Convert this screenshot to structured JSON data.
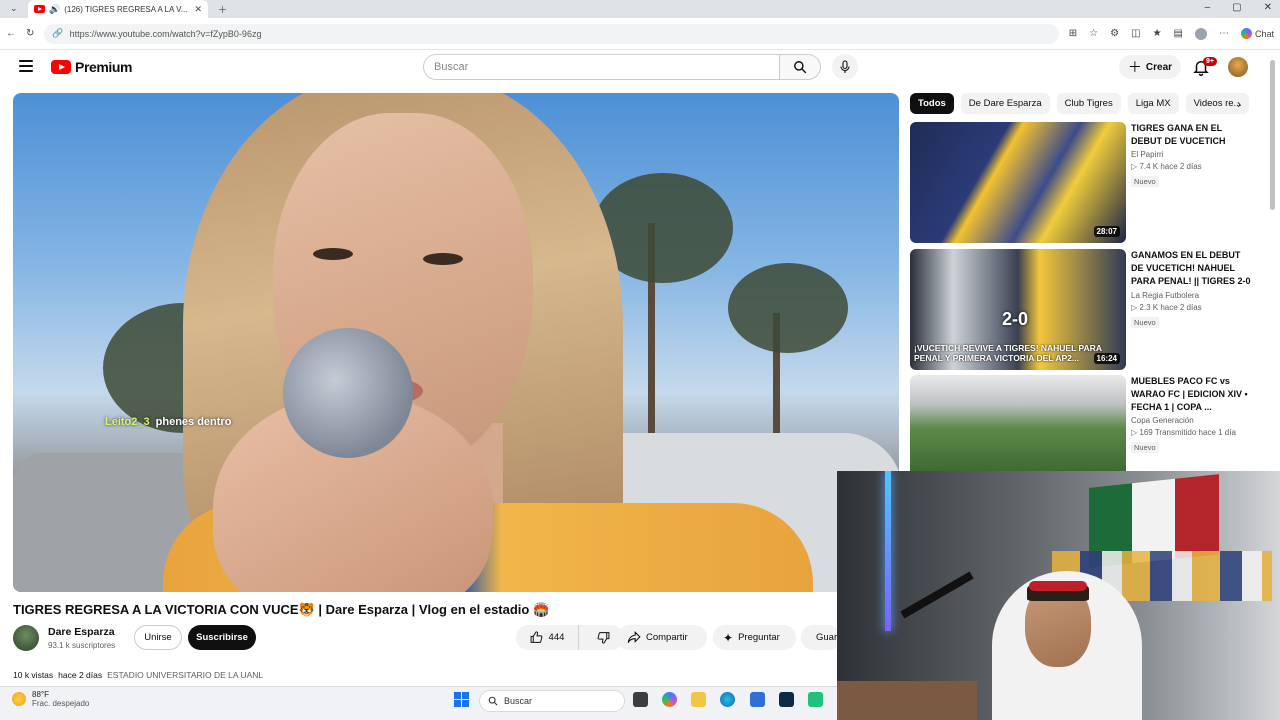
{
  "browser": {
    "tab_title": "(126) TIGRES REGRESA A LA V...",
    "url": "https://www.youtube.com/watch?v=fZypB0-96zg",
    "chat_label": "Chat"
  },
  "youtube": {
    "logo_text": "Premium",
    "search_placeholder": "Buscar",
    "create_label": "Crear",
    "notif_badge": "9+"
  },
  "player": {
    "chat_user": "Leito2_3",
    "chat_text": "phenes dentro"
  },
  "video": {
    "title": "TIGRES REGRESA A LA VICTORIA CON VUCE🐯 | Dare Esparza | Vlog en el estadio 🏟️",
    "channel_name": "Dare Esparza",
    "subscribers": "93.1 k suscriptores",
    "join_label": "Unirse",
    "subscribe_label": "Suscribirse",
    "likes": "444",
    "share_label": "Compartir",
    "ask_label": "Preguntar",
    "save_label": "Guardar",
    "views": "10 k vistas",
    "date": "hace 2 días",
    "location": "ESTADIO UNIVERSITARIO DE LA UANL"
  },
  "chips": [
    "Todos",
    "De Dare Esparza",
    "Club Tigres",
    "Liga MX",
    "Videos re..."
  ],
  "recommendations": [
    {
      "title": "TIGRES GANA EN EL DEBUT DE VUCETICH",
      "channel": "El Papirri",
      "views": "7.4 K",
      "time": "hace 2 días",
      "badge": "Nuevo",
      "duration": "28:07"
    },
    {
      "title": "GANAMOS EN EL DEBUT DE VUCETICH! NAHUEL PARA PENAL! || TIGRES 2-0 ...",
      "channel": "La Regia Futbolera",
      "views": "2.3 K",
      "time": "hace 2 días",
      "badge": "Nuevo",
      "duration": "16:24",
      "thumb_score": "2-0",
      "thumb_caption": "¡VUCETICH REVIVE A TIGRES! NAHUEL PARA PENAL Y PRIMERA VICTORIA DEL AP2..."
    },
    {
      "title": "MUEBLES PACO FC vs WARAO FC | EDICION XIV • FECHA 1 | COPA ...",
      "channel": "Copa Generación",
      "views": "169",
      "time": "Transmitido hace 1 día",
      "badge": "Nuevo"
    }
  ],
  "taskbar": {
    "temp": "88°F",
    "condition": "Frac. despejado",
    "search_label": "Buscar"
  },
  "colors": {
    "yt_red": "#ff0000",
    "subscribe_bg": "#0f0f0f",
    "chip_bg": "#f2f2f2"
  }
}
